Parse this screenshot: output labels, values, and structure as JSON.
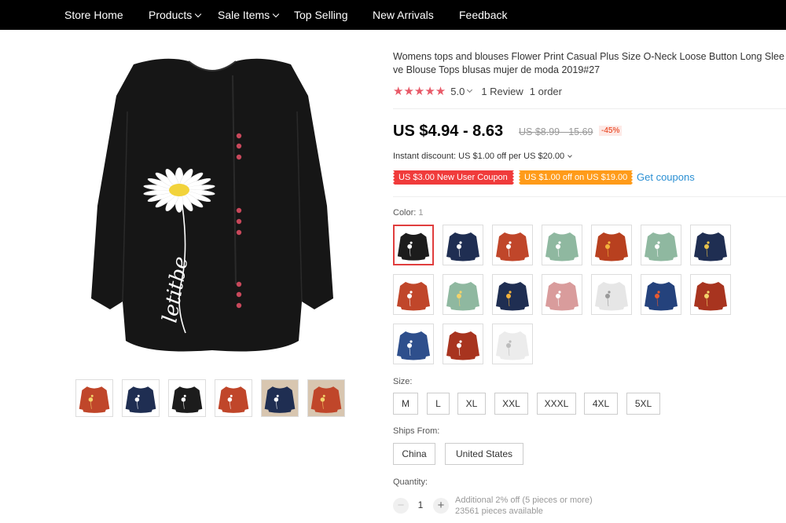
{
  "nav": {
    "items": [
      {
        "label": "Store Home"
      },
      {
        "label": "Products"
      },
      {
        "label": "Sale Items"
      },
      {
        "label": "Top Selling"
      },
      {
        "label": "New Arrivals"
      },
      {
        "label": "Feedback"
      }
    ]
  },
  "product": {
    "title": "Womens tops and blouses Flower Print Casual Plus Size O-Neck Loose Button Long Sleeve Blouse Tops blusas mujer de moda 2019#27",
    "rating": {
      "stars": "★★★★★",
      "score": "5.0",
      "reviews": "1 Review",
      "orders": "1 order"
    },
    "price": {
      "range": "US $4.94 - 8.63",
      "original": "US $8.99 - 15.69",
      "discount": "-45%"
    },
    "instant_discount": "Instant discount: US $1.00 off per US $20.00",
    "coupons": {
      "new_user": "US $3.00 New User Coupon",
      "store": "US $1.00 off on US $19.00",
      "get_link": "Get coupons"
    },
    "color": {
      "label": "Color:",
      "selected_index": "1",
      "swatches": [
        {
          "color": "#1c1c1c",
          "flower": "#ffffff"
        },
        {
          "color": "#1f2e52",
          "flower": "#ffffff"
        },
        {
          "color": "#c0462a",
          "flower": "#ffffff"
        },
        {
          "color": "#8fb8a0",
          "flower": "#ffffff"
        },
        {
          "color": "#b8401f",
          "flower": "#f3b23c"
        },
        {
          "color": "#8fb8a0",
          "flower": "#ffffff"
        },
        {
          "color": "#1f2e52",
          "flower": "#e7c14b"
        },
        {
          "color": "#c0462a",
          "flower": "#ffffff"
        },
        {
          "color": "#8fb8a0",
          "flower": "#f3d36b"
        },
        {
          "color": "#1f2e52",
          "flower": "#f3b23c"
        },
        {
          "color": "#d99c9c",
          "flower": "#ffffff"
        },
        {
          "color": "#e6e6e6",
          "flower": "#9a9a9a"
        },
        {
          "color": "#24427c",
          "flower": "#e85a30"
        },
        {
          "color": "#a8341f",
          "flower": "#f3d36b"
        },
        {
          "color": "#2e4f8c",
          "flower": "#ffffff"
        },
        {
          "color": "#a8341f",
          "flower": "#ffffff"
        },
        {
          "color": "#ececec",
          "flower": "#bcbcbc"
        }
      ]
    },
    "size": {
      "label": "Size:",
      "options": [
        "M",
        "L",
        "XL",
        "XXL",
        "XXXL",
        "4XL",
        "5XL"
      ]
    },
    "ships_from": {
      "label": "Ships From:",
      "options": [
        "China",
        "United States"
      ]
    },
    "quantity": {
      "label": "Quantity:",
      "value": "1",
      "minus": "−",
      "plus": "+",
      "note": "Additional 2% off (5 pieces or more)",
      "available": "23561 pieces available"
    },
    "main_image": {
      "color": "#161616",
      "flower": "#ffffff",
      "center": "#f2d33b",
      "button_color": "#c8485b",
      "script_text": "letitbe"
    },
    "thumbnails": [
      {
        "color": "#c0462a",
        "flower": "#f3d36b",
        "bg": "#ffffff"
      },
      {
        "color": "#1f2e52",
        "flower": "#ffffff",
        "bg": "#ffffff"
      },
      {
        "color": "#1c1c1c",
        "flower": "#ffffff",
        "bg": "#ffffff"
      },
      {
        "color": "#c0462a",
        "flower": "#ffffff",
        "bg": "#ffffff"
      },
      {
        "color": "#1f2e52",
        "flower": "#ffffff",
        "bg": "#d8c6b0"
      },
      {
        "color": "#c0462a",
        "flower": "#f3d36b",
        "bg": "#d8c6b0"
      }
    ]
  }
}
